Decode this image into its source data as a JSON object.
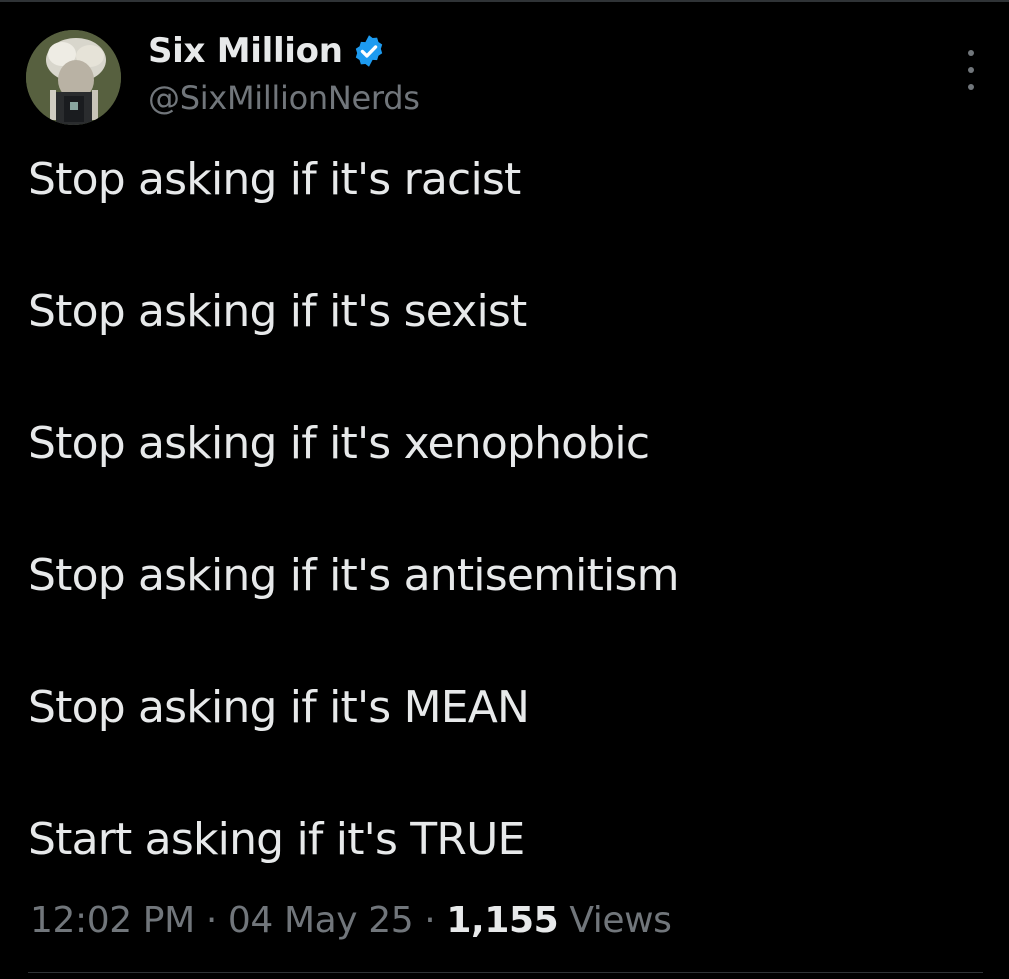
{
  "tweet": {
    "author": {
      "display_name": "Six Million",
      "handle": "@SixMillionNerds",
      "verified": true,
      "verified_color": "#1d9bf0",
      "avatar_icon": "profile-photo"
    },
    "more_icon": "more-vertical-icon",
    "lines": [
      "Stop asking if it's racist",
      "Stop asking if it's sexist",
      "Stop asking if it's xenophobic",
      "Stop asking if it's antisemitism",
      "Stop asking if it's MEAN",
      "Start asking if it's TRUE"
    ],
    "meta": {
      "time": "12:02 PM",
      "separator": "·",
      "date": "04 May 25",
      "views_count": "1,155",
      "views_label": "Views"
    }
  },
  "colors": {
    "background": "#000000",
    "text_primary": "#e7e9ea",
    "text_secondary": "#71767b",
    "divider": "#2f3336"
  }
}
